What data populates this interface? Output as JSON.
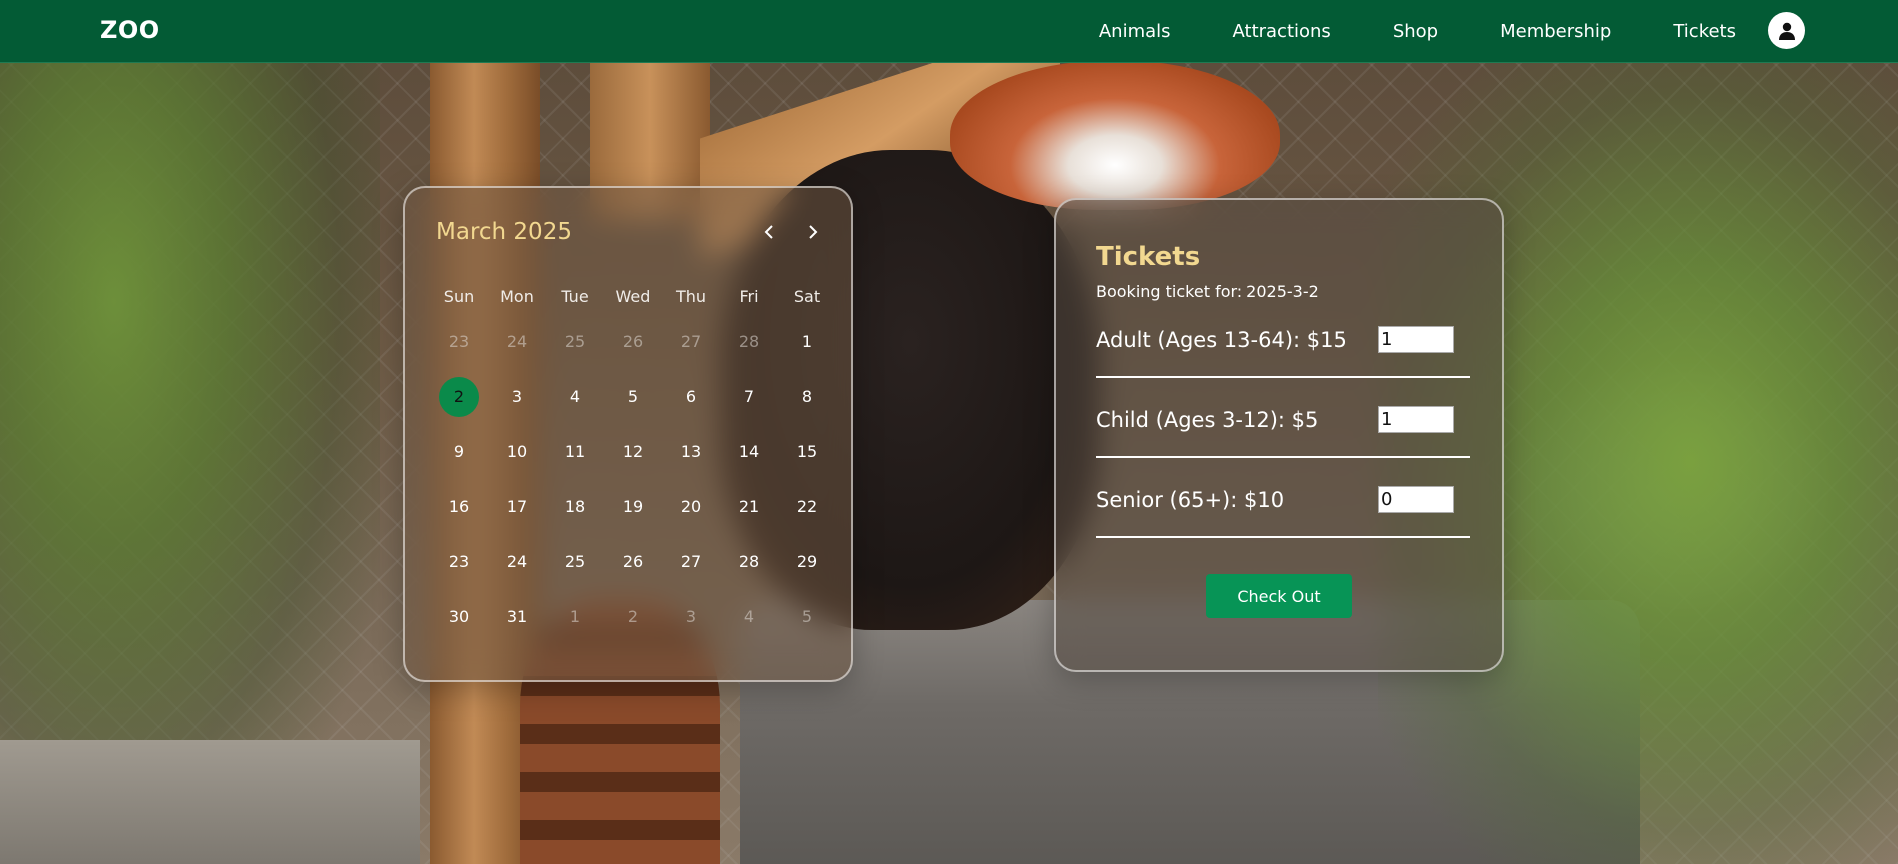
{
  "nav": {
    "logo": "ZOO",
    "links": [
      "Animals",
      "Attractions",
      "Shop",
      "Membership",
      "Tickets"
    ],
    "avatar_icon": "user-icon"
  },
  "calendar": {
    "title": "March 2025",
    "prev_icon": "chevron-left-icon",
    "next_icon": "chevron-right-icon",
    "weekdays": [
      "Sun",
      "Mon",
      "Tue",
      "Wed",
      "Thu",
      "Fri",
      "Sat"
    ],
    "weeks": [
      [
        {
          "d": "23",
          "m": true
        },
        {
          "d": "24",
          "m": true
        },
        {
          "d": "25",
          "m": true
        },
        {
          "d": "26",
          "m": true
        },
        {
          "d": "27",
          "m": true
        },
        {
          "d": "28",
          "m": true
        },
        {
          "d": "1"
        }
      ],
      [
        {
          "d": "2",
          "sel": true
        },
        {
          "d": "3"
        },
        {
          "d": "4"
        },
        {
          "d": "5"
        },
        {
          "d": "6"
        },
        {
          "d": "7"
        },
        {
          "d": "8"
        }
      ],
      [
        {
          "d": "9"
        },
        {
          "d": "10"
        },
        {
          "d": "11"
        },
        {
          "d": "12"
        },
        {
          "d": "13"
        },
        {
          "d": "14"
        },
        {
          "d": "15"
        }
      ],
      [
        {
          "d": "16"
        },
        {
          "d": "17"
        },
        {
          "d": "18"
        },
        {
          "d": "19"
        },
        {
          "d": "20"
        },
        {
          "d": "21"
        },
        {
          "d": "22"
        }
      ],
      [
        {
          "d": "23"
        },
        {
          "d": "24"
        },
        {
          "d": "25"
        },
        {
          "d": "26"
        },
        {
          "d": "27"
        },
        {
          "d": "28"
        },
        {
          "d": "29"
        }
      ],
      [
        {
          "d": "30"
        },
        {
          "d": "31"
        },
        {
          "d": "1",
          "m": true
        },
        {
          "d": "2",
          "m": true
        },
        {
          "d": "3",
          "m": true
        },
        {
          "d": "4",
          "m": true
        },
        {
          "d": "5",
          "m": true
        }
      ]
    ]
  },
  "tickets": {
    "title": "Tickets",
    "booking_label": "Booking ticket for:",
    "booking_date": "2025-3-2",
    "rows": [
      {
        "label": "Adult (Ages 13-64): $15",
        "qty": "1"
      },
      {
        "label": "Child (Ages 3-12): $5",
        "qty": "1"
      },
      {
        "label": "Senior (65+): $10",
        "qty": "0"
      }
    ],
    "checkout_label": "Check Out"
  },
  "colors": {
    "nav_bg": "#035b35",
    "accent": "#079456",
    "title_gold": "#f2d890"
  }
}
